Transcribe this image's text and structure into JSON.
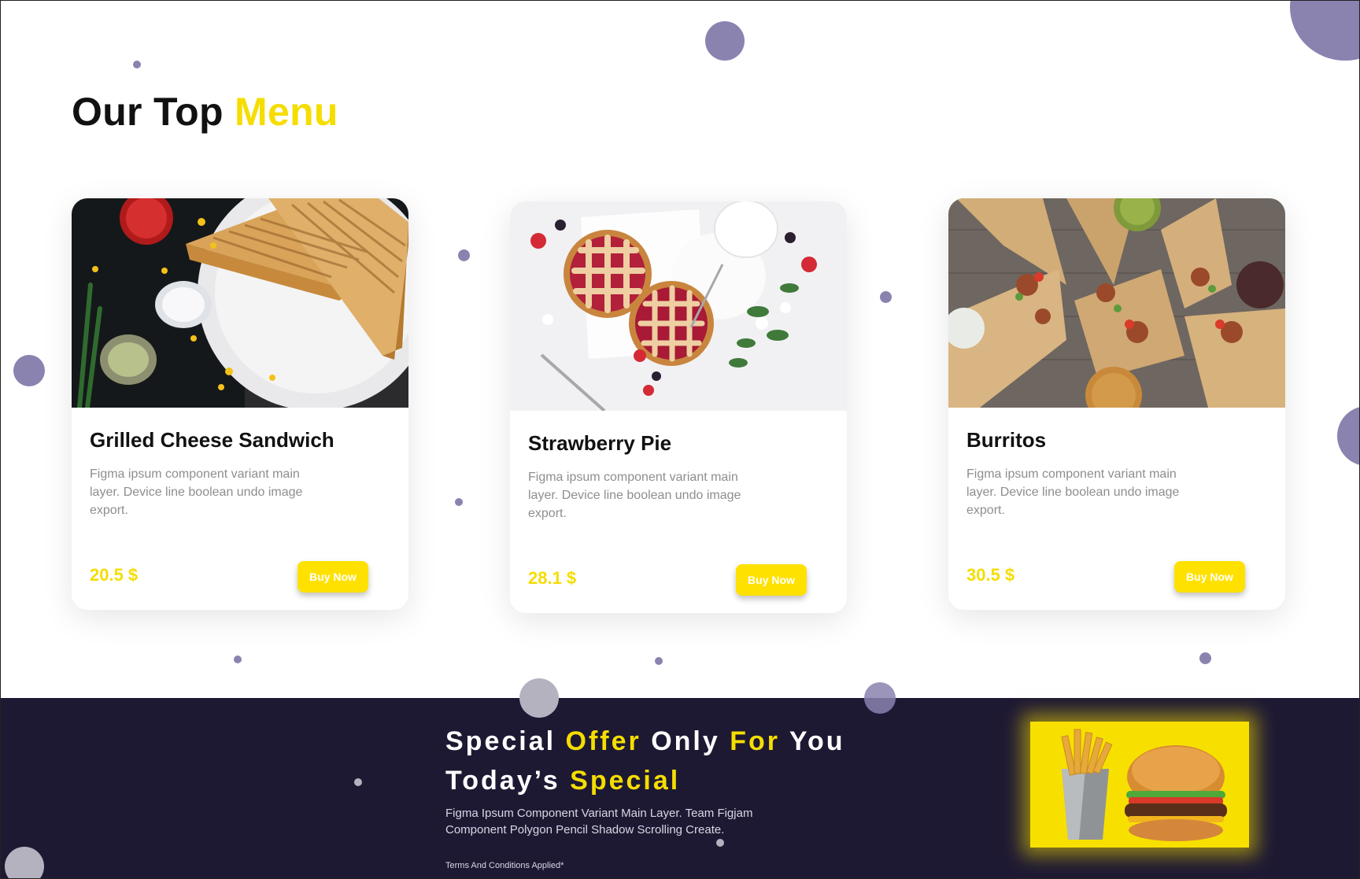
{
  "section": {
    "heading_part1": "Our Top",
    "heading_part2": "Menu"
  },
  "cards": [
    {
      "title": "Grilled Cheese Sandwich",
      "description": "Figma ipsum component variant main layer. Device line boolean undo image export.",
      "price": "20.5 $",
      "button": "Buy Now",
      "image_icon": "grilled-cheese-sandwich-photo"
    },
    {
      "title": "Strawberry Pie",
      "description": "Figma ipsum component variant main layer. Device line boolean undo image export.",
      "price": "28.1 $",
      "button": "Buy Now",
      "image_icon": "strawberry-pie-photo"
    },
    {
      "title": "Burritos",
      "description": "Figma ipsum component variant main layer. Device line boolean undo image export.",
      "price": "30.5 $",
      "button": "Buy Now",
      "image_icon": "burritos-photo"
    }
  ],
  "offer": {
    "line1_a": "Special",
    "line1_b": "Offer",
    "line1_c": "Only",
    "line1_d": "For",
    "line1_e": "You",
    "line2_a": "Today’s",
    "line2_b": "Special",
    "description": "Figma Ipsum Component Variant Main Layer. Team Figjam Component Polygon Pencil Shadow Scrolling Create.",
    "terms": "Terms And Conditions Applied*",
    "image_icon": "burger-and-fries-photo"
  },
  "colors": {
    "accent": "#f5dd00",
    "button": "#ffe100",
    "footer_bg": "#1e1933",
    "decor_dot": "#8a83b0",
    "muted_text": "#8e8e8e"
  }
}
